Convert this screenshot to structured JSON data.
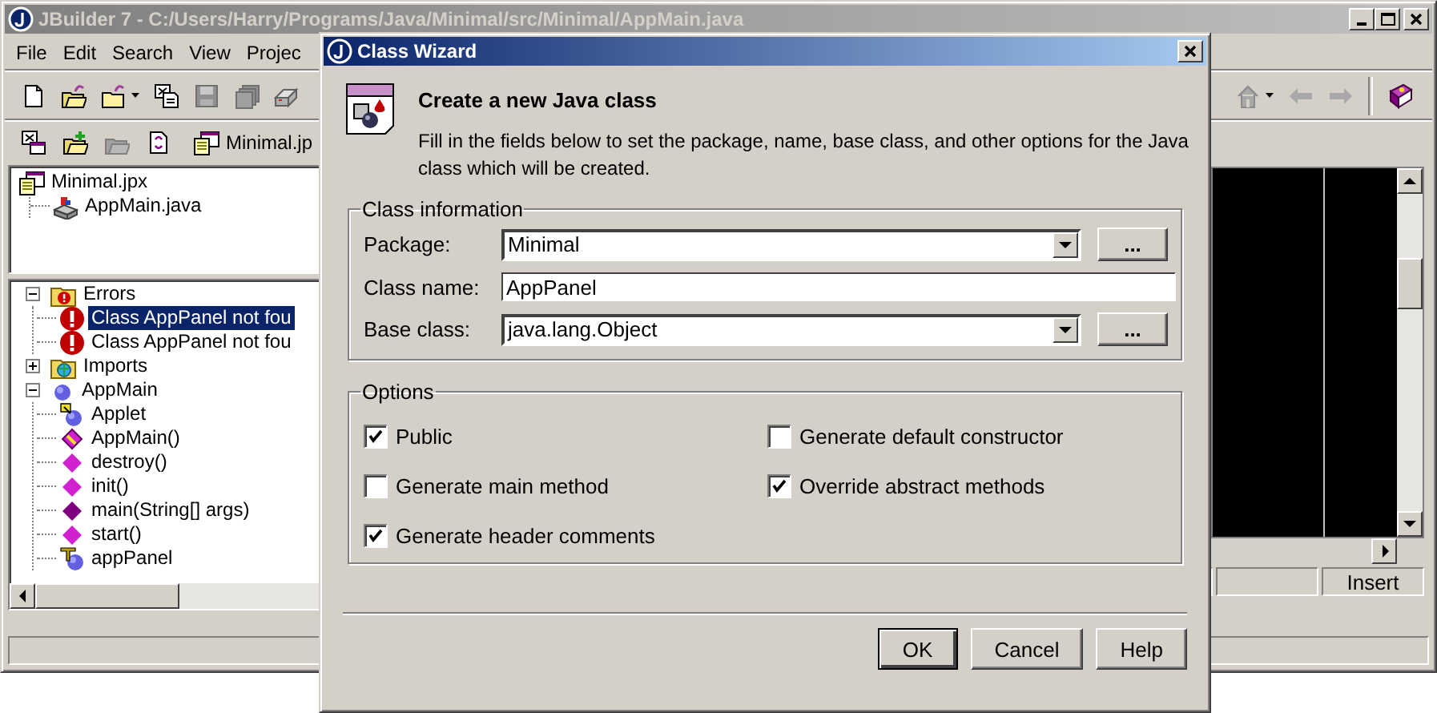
{
  "main_window": {
    "title": "JBuilder 7 - C:/Users/Harry/Programs/Java/Minimal/src/Minimal/AppMain.java",
    "menu": [
      "File",
      "Edit",
      "Search",
      "View",
      "Projec"
    ],
    "project_tab": "Minimal.jp",
    "project_tree": [
      {
        "label": "Minimal.jpx",
        "kind": "project",
        "selected": false,
        "children": [
          {
            "label": "AppMain.java",
            "kind": "java-file",
            "selected": false
          }
        ]
      }
    ],
    "structure_tree": [
      {
        "label": "Errors",
        "kind": "error-folder",
        "expanded": true,
        "selected": false,
        "children": [
          {
            "label": "Class AppPanel not fou",
            "kind": "error",
            "selected": true
          },
          {
            "label": "Class AppPanel not fou",
            "kind": "error",
            "selected": false
          }
        ]
      },
      {
        "label": "Imports",
        "kind": "package-folder",
        "expanded": false,
        "selected": false
      },
      {
        "label": "AppMain",
        "kind": "class",
        "expanded": true,
        "selected": false,
        "children": [
          {
            "label": "Applet",
            "kind": "superclass",
            "selected": false
          },
          {
            "label": "AppMain()",
            "kind": "constructor",
            "selected": false
          },
          {
            "label": "destroy()",
            "kind": "method",
            "selected": false
          },
          {
            "label": "init()",
            "kind": "method",
            "selected": false
          },
          {
            "label": "main(String[] args)",
            "kind": "static-method",
            "selected": false
          },
          {
            "label": "start()",
            "kind": "method",
            "selected": false
          },
          {
            "label": "appPanel",
            "kind": "field",
            "selected": false
          }
        ]
      }
    ],
    "editor_mode": "Insert"
  },
  "dialog": {
    "title": "Class Wizard",
    "heading": "Create a new Java class",
    "description": "Fill in the fields below to set the package, name, base class, and other options for the Java class which will be created.",
    "class_information": {
      "title": "Class information",
      "fields": [
        {
          "kind": "combo",
          "label": "Package:",
          "value": "Minimal",
          "button": "..."
        },
        {
          "kind": "text",
          "label": "Class name:",
          "value": "AppPanel"
        },
        {
          "kind": "combo",
          "label": "Base class:",
          "value": "java.lang.Object",
          "button": "..."
        }
      ]
    },
    "options": {
      "title": "Options",
      "checkboxes": [
        {
          "label": "Public",
          "checked": true
        },
        {
          "label": "Generate default constructor",
          "checked": false
        },
        {
          "label": "Generate main method",
          "checked": false
        },
        {
          "label": "Override abstract methods",
          "checked": true
        },
        {
          "label": "Generate header comments",
          "checked": true
        }
      ]
    },
    "buttons": [
      {
        "label": "OK",
        "default": true
      },
      {
        "label": "Cancel",
        "default": false
      },
      {
        "label": "Help",
        "default": false
      }
    ]
  }
}
